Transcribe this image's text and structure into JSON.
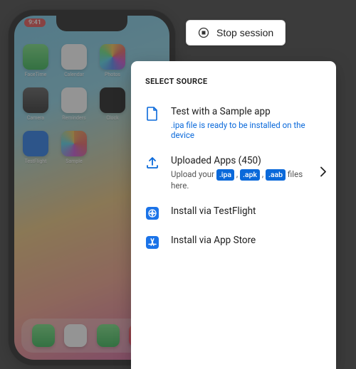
{
  "session": {
    "stop_label": "Stop session"
  },
  "phone": {
    "time": "9:41",
    "apps": [
      {
        "label": "FaceTime"
      },
      {
        "label": "Calendar"
      },
      {
        "label": "Photos"
      },
      {
        "label": "Camera"
      },
      {
        "label": "Reminders"
      },
      {
        "label": "Clock"
      },
      {
        "label": "TestFlight"
      },
      {
        "label": "Sample"
      }
    ],
    "dock": [
      "Phone",
      "Safari",
      "Messages",
      "Music"
    ]
  },
  "panel": {
    "title": "SELECT SOURCE",
    "options": {
      "sample": {
        "title": "Test with a Sample app",
        "sub": ".ipa file is ready to be installed on the device"
      },
      "uploaded": {
        "title_prefix": "Uploaded Apps (",
        "count": "450",
        "title_suffix": ")",
        "sub_prefix": "Upload your ",
        "chip_ipa": ".ipa",
        "sep1": " , ",
        "chip_apk": ".apk",
        "sep2": " , ",
        "chip_aab": ".aab",
        "sub_suffix": " files here."
      },
      "testflight": {
        "title": "Install via TestFlight"
      },
      "appstore": {
        "title": "Install via App Store"
      }
    }
  },
  "colors": {
    "accent": "#0a69da"
  }
}
